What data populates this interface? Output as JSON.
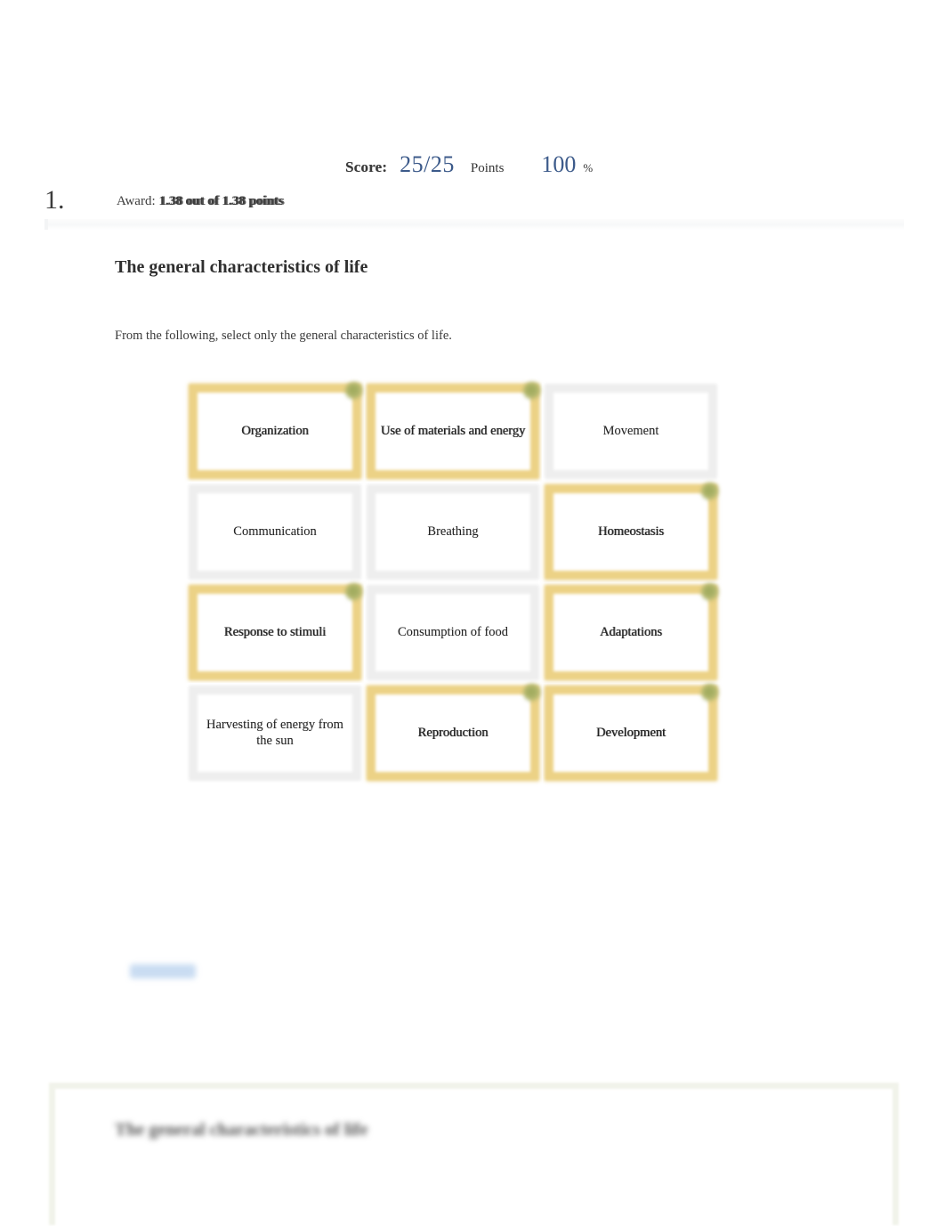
{
  "score": {
    "label": "Score:",
    "value": "25/25",
    "unit": "Points",
    "percent": "100",
    "percent_sign": "%",
    "value_color": "#3c5a8a"
  },
  "question": {
    "number": "1.",
    "award_prefix": "Award:",
    "award_earned": "1.38",
    "award_middle": "out of",
    "award_total": "1.38",
    "award_suffix": "points",
    "title": "The general characteristics of life",
    "prompt": "From the following, select only the general characteristics of life."
  },
  "grid": {
    "selected_border_color": "#ecd286",
    "unselected_border_color": "#eeeeee",
    "check_color": "#9aa758",
    "cards": [
      {
        "label": "Organization",
        "selected": true
      },
      {
        "label": "Use of materials and energy",
        "selected": true
      },
      {
        "label": "Movement",
        "selected": false
      },
      {
        "label": "Communication",
        "selected": false
      },
      {
        "label": "Breathing",
        "selected": false
      },
      {
        "label": "Homeostasis",
        "selected": true
      },
      {
        "label": "Response to stimuli",
        "selected": true
      },
      {
        "label": "Consumption of food",
        "selected": false
      },
      {
        "label": "Adaptations",
        "selected": true
      },
      {
        "label": "Harvesting of energy from the sun",
        "selected": false
      },
      {
        "label": "Reproduction",
        "selected": true
      },
      {
        "label": "Development",
        "selected": true
      }
    ]
  },
  "feedback": {
    "link_label": "",
    "columns": [
      "",
      "",
      ""
    ]
  },
  "bottom_panel": {
    "title": "The general characteristics of life"
  }
}
